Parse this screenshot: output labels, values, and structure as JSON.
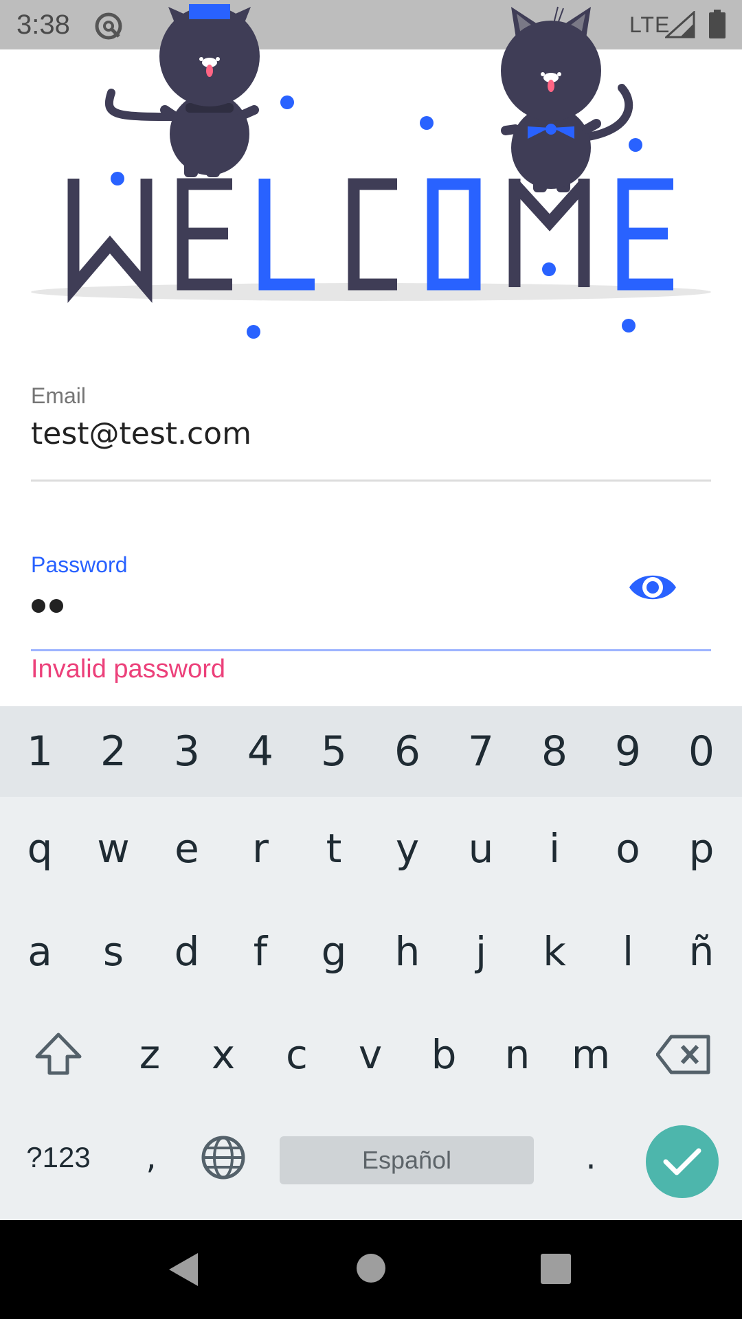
{
  "status_bar": {
    "time": "3:38",
    "network": "LTE",
    "app_icon": "app-notification-icon",
    "signal_icon": "signal-icon",
    "battery_icon": "battery-icon"
  },
  "illustration": {
    "text_welcome_letters": [
      "W",
      "E",
      "L",
      "C",
      "O",
      "M",
      "E"
    ],
    "colors": {
      "dark": "#3f3d56",
      "accent": "#2962ff",
      "floor": "#e6e6e6"
    }
  },
  "form": {
    "email": {
      "label": "Email",
      "value": "test@test.com"
    },
    "password": {
      "label": "Password",
      "masked_length": 2,
      "toggle_icon": "eye-icon",
      "error": "Invalid password"
    }
  },
  "keyboard": {
    "number_row": [
      "1",
      "2",
      "3",
      "4",
      "5",
      "6",
      "7",
      "8",
      "9",
      "0"
    ],
    "row1": [
      "q",
      "w",
      "e",
      "r",
      "t",
      "y",
      "u",
      "i",
      "o",
      "p"
    ],
    "row2": [
      "a",
      "s",
      "d",
      "f",
      "g",
      "h",
      "j",
      "k",
      "l",
      "ñ"
    ],
    "row3": [
      "z",
      "x",
      "c",
      "v",
      "b",
      "n",
      "m"
    ],
    "symbols_label": "?123",
    "comma": ",",
    "period": ".",
    "space_label": "Español",
    "enter_icon": "check-icon",
    "shift_icon": "shift-icon",
    "backspace_icon": "backspace-icon",
    "language_icon": "globe-icon",
    "enter_color": "#4db6ac"
  },
  "nav_bar": {
    "back_icon": "back-icon",
    "home_icon": "home-icon",
    "recents_icon": "recents-icon"
  }
}
